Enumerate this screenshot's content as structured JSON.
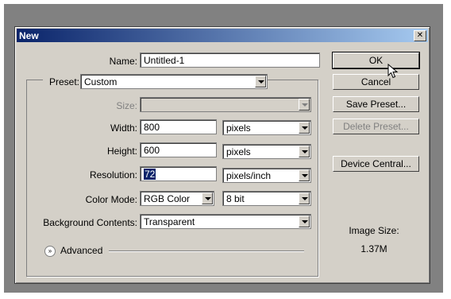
{
  "dialog": {
    "title": "New",
    "close_glyph": "✕"
  },
  "form": {
    "name_label": "Name:",
    "name_value": "Untitled-1",
    "preset_label": "Preset:",
    "preset_value": "Custom",
    "size_label": "Size:",
    "size_value": "",
    "width_label": "Width:",
    "width_value": "800",
    "width_unit": "pixels",
    "height_label": "Height:",
    "height_value": "600",
    "height_unit": "pixels",
    "resolution_label": "Resolution:",
    "resolution_value": "72",
    "resolution_unit": "pixels/inch",
    "color_mode_label": "Color Mode:",
    "color_mode_value": "RGB Color",
    "bit_depth_value": "8 bit",
    "background_label": "Background Contents:",
    "background_value": "Transparent",
    "advanced_label": "Advanced",
    "advanced_glyph": "»"
  },
  "buttons": {
    "ok": "OK",
    "cancel": "Cancel",
    "save_preset": "Save Preset...",
    "delete_preset": "Delete Preset...",
    "device_central": "Device Central..."
  },
  "image_size": {
    "label": "Image Size:",
    "value": "1.37M"
  },
  "icons": {
    "close": "close-icon",
    "dropdown": "chevron-down-icon",
    "expand": "expand-icon",
    "cursor": "mouse-pointer-icon"
  }
}
